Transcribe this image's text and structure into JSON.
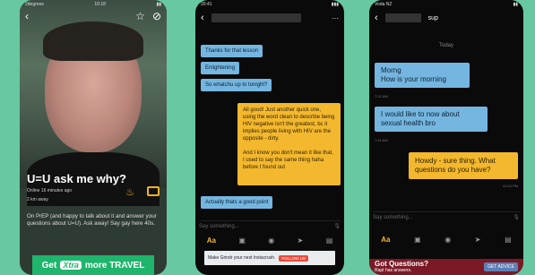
{
  "profile": {
    "carrier": "2degrees",
    "time": "10:18",
    "headline": "U=U ask me why?",
    "online": "Online 16 minutes ago",
    "distance": "2 km away",
    "about": "On PrEP (and happy to talk about it and answer your questions about U=U). Ask away! Say gay here 40s.",
    "banner_get": "Get",
    "banner_brand": "Xtra",
    "banner_rest": "more TRAVEL"
  },
  "chat1": {
    "time": "20:41",
    "messages_in": [
      "Thanks for that lesson",
      "Enlightening",
      "So whatchu up to tonight?"
    ],
    "message_out": "All good! Just another quick one, using the word clean to describe being HIV negative isn't the greatest, bc it implies people living with HIV are the opposite - dirty.\n\nAnd I know you don't mean it like that, I used to say the same thing haha before I found out",
    "reply_in": "Actually thats a good point",
    "placeholder": "Say something...",
    "ad_text": "Make Grindr your next Instacrush.",
    "ad_btn": "FOLLOW US"
  },
  "chat2": {
    "carrier": "Voda NZ",
    "name": "sup",
    "day": "Today",
    "msg1": "Morng\nHow is your morning",
    "ts1": "7:21 AM",
    "msg2": "I would like to now about sexual health bro",
    "ts2": "7:41 AM",
    "msg3": "Howdy - sure thing. What questions do you have?",
    "ts3": "12:24 PM",
    "placeholder": "Say something...",
    "ad_title": "Got Questions?",
    "ad_sub": "Rapt has answers.",
    "ad_btn": "GET ADVICE"
  },
  "colors": {
    "background": "#67c8a1",
    "incoming": "#74b6e0",
    "outgoing": "#f4b82e",
    "accent": "#1fb56c"
  }
}
